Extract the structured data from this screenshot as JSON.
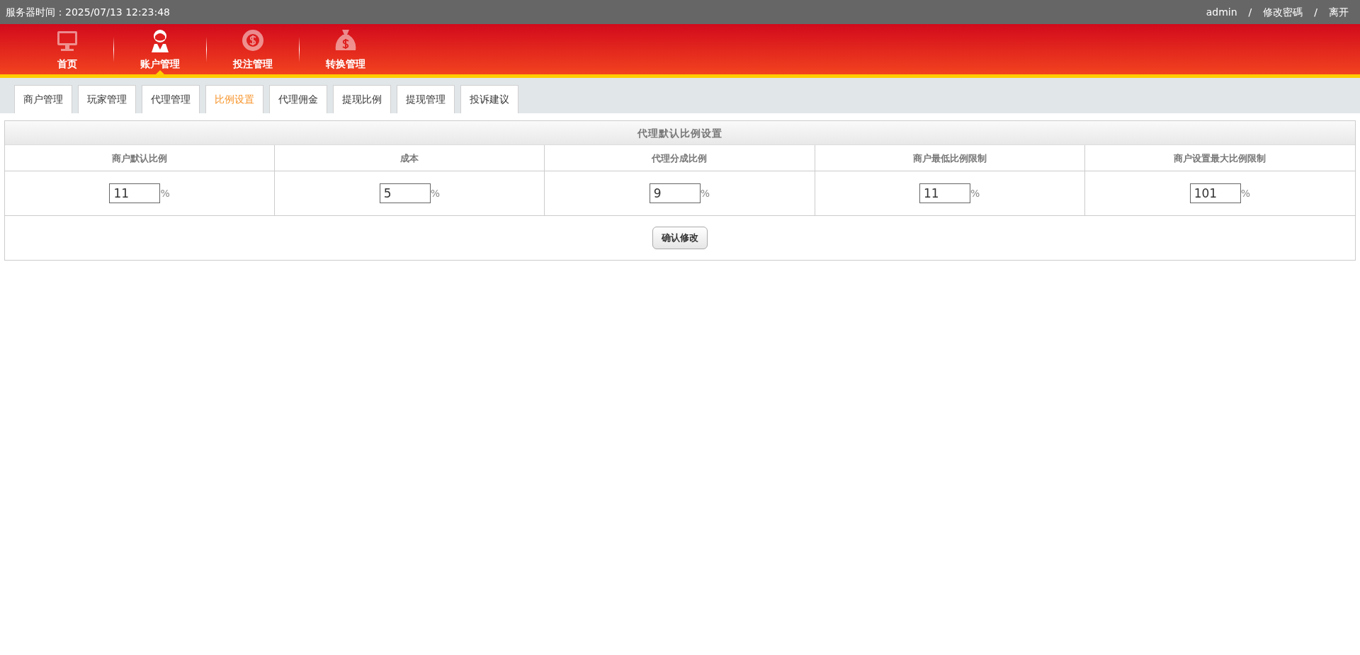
{
  "topbar": {
    "server_time": "服务器时间：2025/07/13 12:23:48",
    "user": "admin",
    "links": [
      "修改密碼",
      "离开"
    ],
    "separator": "/"
  },
  "main_nav": [
    {
      "label": "首页",
      "kind": "monitor",
      "selected": false
    },
    {
      "label": "账户管理",
      "kind": "user",
      "selected": true
    },
    {
      "label": "投注管理",
      "kind": "chip",
      "selected": false
    },
    {
      "label": "转换管理",
      "kind": "moneybag",
      "selected": false
    }
  ],
  "tabs": [
    {
      "label": "商户管理",
      "selected": false
    },
    {
      "label": "玩家管理",
      "selected": false
    },
    {
      "label": "代理管理",
      "selected": false
    },
    {
      "label": "比例设置",
      "selected": true
    },
    {
      "label": "代理佣金",
      "selected": false
    },
    {
      "label": "提现比例",
      "selected": false
    },
    {
      "label": "提现管理",
      "selected": false
    },
    {
      "label": "投诉建议",
      "selected": false
    }
  ],
  "panel": {
    "title": "代理默认比例设置",
    "fields": [
      {
        "label": "商户默认比例",
        "value": "11",
        "unit": "%"
      },
      {
        "label": "成本",
        "value": "5",
        "unit": "%"
      },
      {
        "label": "代理分成比例",
        "value": "9",
        "unit": "%"
      },
      {
        "label": "商户最低比例限制",
        "value": "11",
        "unit": "%"
      },
      {
        "label": "商户设置最大比例限制",
        "value": "101",
        "unit": "%"
      }
    ],
    "submit": "确认修改"
  }
}
